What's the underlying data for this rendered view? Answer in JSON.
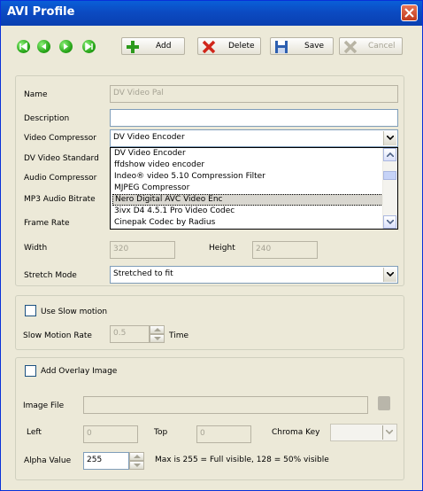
{
  "window": {
    "title": "AVI Profile"
  },
  "toolbar": {
    "add_label": "Add",
    "delete_label": "Delete",
    "save_label": "Save",
    "cancel_label": "Cancel"
  },
  "profile": {
    "name_label": "Name",
    "name_value": "DV Video Pal",
    "description_label": "Description",
    "description_value": "",
    "video_compressor_label": "Video Compressor",
    "video_compressor_value": "DV Video Encoder",
    "dv_video_standard_label": "DV Video Standard",
    "audio_compressor_label": "Audio Compressor",
    "mp3_audio_bitrate_label": "MP3 Audio Bitrate",
    "frame_rate_label": "Frame Rate",
    "width_label": "Width",
    "width_value": "320",
    "height_label": "Height",
    "height_value": "240",
    "stretch_mode_label": "Stretch Mode",
    "stretch_mode_value": "Stretched to fit"
  },
  "compressor_dropdown": {
    "options": [
      "DV Video Encoder",
      "ffdshow video encoder",
      "Indeo® video 5.10 Compression Filter",
      "MJPEG Compressor",
      "Nero Digital AVC Video Enc",
      "3ivx D4 4.5.1 Pro Video Codec",
      "Cinepak Codec by Radius"
    ],
    "selected_index": 4
  },
  "slow_motion": {
    "checkbox_label": "Use Slow motion",
    "rate_label": "Slow Motion Rate",
    "rate_value": "0.5",
    "time_label": "Time"
  },
  "overlay": {
    "checkbox_label": "Add Overlay Image",
    "image_file_label": "Image File",
    "image_file_value": "",
    "left_label": "Left",
    "left_value": "0",
    "top_label": "Top",
    "top_value": "0",
    "chroma_key_label": "Chroma Key",
    "alpha_label": "Alpha Value",
    "alpha_value": "255",
    "alpha_hint": "Max is 255 = Full visible, 128 = 50% visible"
  },
  "colors": {
    "titlebar": "#0a4fc8",
    "window_bg": "#ece9d8",
    "nav_green": "#2aa81b",
    "delete_red": "#d0261a",
    "add_green": "#2c9a1c"
  }
}
